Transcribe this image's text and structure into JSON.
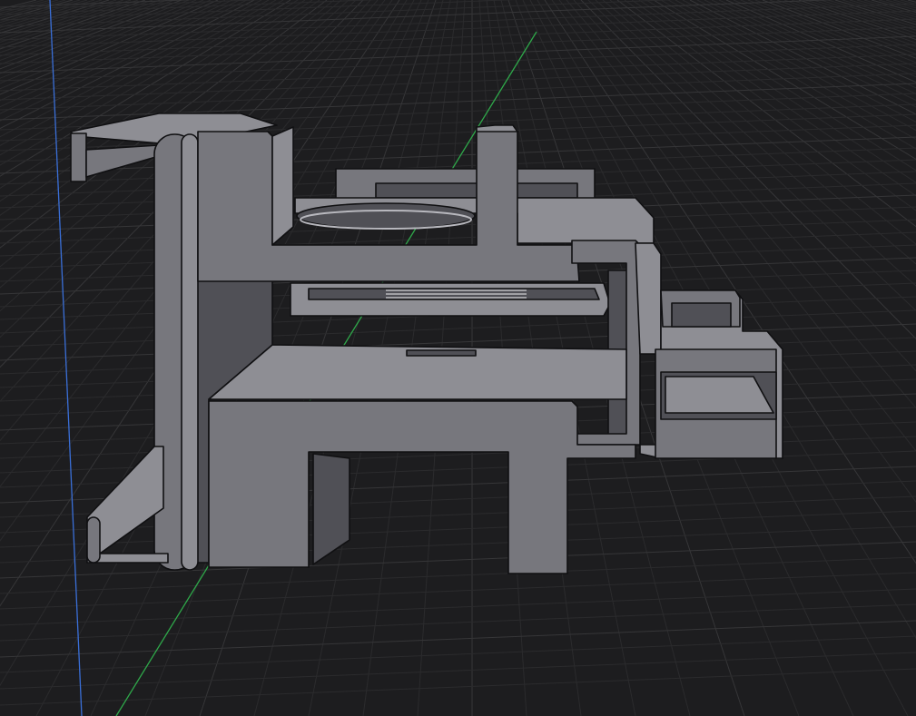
{
  "app": {
    "view": "3d-model-viewport",
    "background_color": "#1d1d1f"
  },
  "scene": {
    "grid": {
      "visible": true,
      "minor_color": "#2b2b2d",
      "major_color": "#363638"
    },
    "axes": {
      "vertical_axis_color": "#3a6fd8",
      "depth_axis_color": "#2fa84a"
    },
    "model": {
      "selected": false,
      "shading": "solid-with-edges",
      "face_color": "#77777d",
      "top_face_color": "#8e8e94",
      "dark_face_color": "#505056",
      "edge_color": "#101012"
    }
  }
}
